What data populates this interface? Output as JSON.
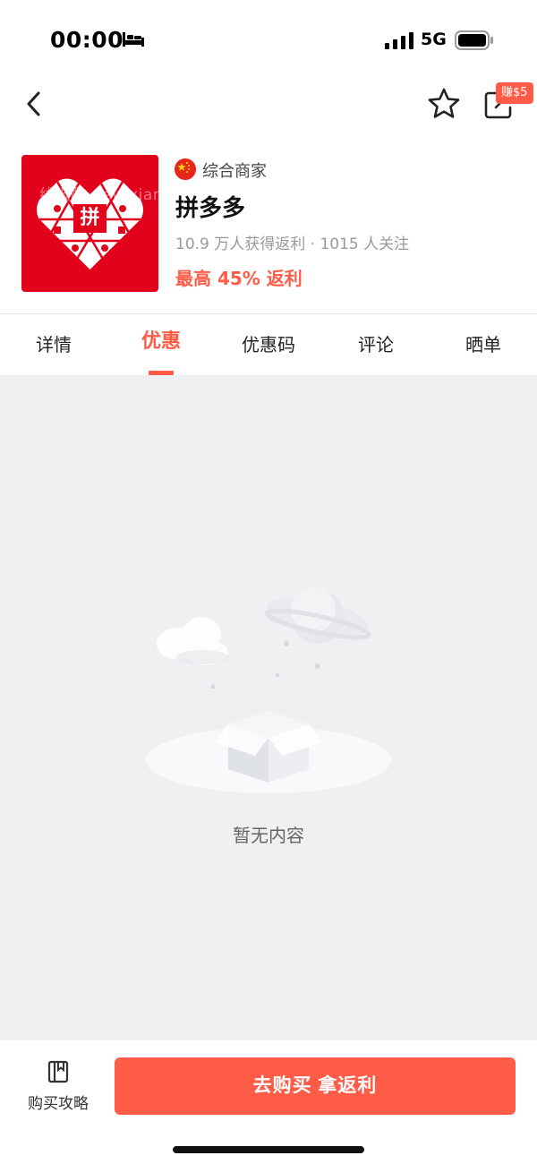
{
  "status_bar": {
    "time": "00:00",
    "network": "5G"
  },
  "nav": {
    "earn_badge": "赚$5"
  },
  "merchant": {
    "type": "综合商家",
    "name": "拼多多",
    "stats": "10.9 万人获得返利 · 1015 人关注",
    "rebate": "最高 45% 返利",
    "logo_text": "拼",
    "watermark": "线报酷-new.xianbao.fun",
    "brand_color": "#e3021b"
  },
  "tabs": [
    {
      "label": "详情"
    },
    {
      "label": "优惠"
    },
    {
      "label": "优惠码"
    },
    {
      "label": "评论"
    },
    {
      "label": "晒单"
    }
  ],
  "active_tab": "优惠",
  "content": {
    "empty_text": "暂无内容"
  },
  "bottom": {
    "guide_label": "购买攻略",
    "buy_button": "去购买 拿返利"
  },
  "colors": {
    "accent": "#ff5c47",
    "content_bg": "#eff0f2"
  }
}
